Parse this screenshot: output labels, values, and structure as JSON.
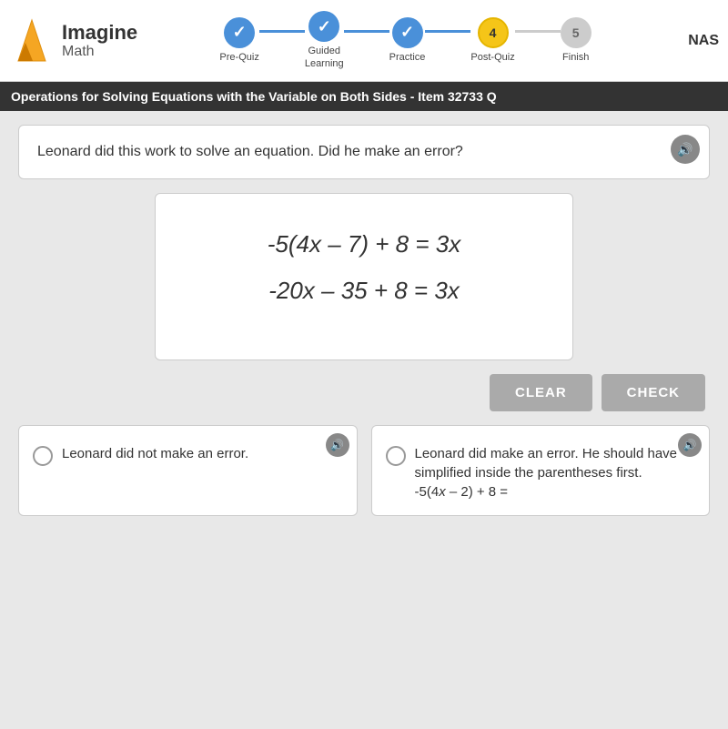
{
  "header": {
    "logo_imagine": "Imagine",
    "logo_math": "Math",
    "nas_label": "NAS"
  },
  "progress": {
    "steps": [
      {
        "id": "pre-quiz",
        "label": "Pre-Quiz",
        "state": "completed",
        "number": "✓"
      },
      {
        "id": "guided-learning",
        "label": "Guided\nLearning",
        "state": "completed",
        "number": "✓"
      },
      {
        "id": "practice",
        "label": "Practice",
        "state": "completed",
        "number": "✓"
      },
      {
        "id": "post-quiz",
        "label": "Post-Quiz",
        "state": "active",
        "number": "4"
      },
      {
        "id": "finish",
        "label": "Finish",
        "state": "future",
        "number": "5"
      }
    ]
  },
  "title_bar": {
    "text": "Operations for Solving Equations with the Variable on Both Sides - Item 32733  Q"
  },
  "question": {
    "text": "Leonard did this work to solve an equation. Did he make an error?",
    "speaker_label": "🔊"
  },
  "math_display": {
    "line1": "-5(4x – 7) + 8 = 3x",
    "line2": "-20x – 35 + 8 = 3x"
  },
  "buttons": {
    "clear_label": "CLEAR",
    "check_label": "CHECK"
  },
  "answer_options": [
    {
      "id": "option-a",
      "text": "Leonard did not make an error.",
      "speaker_label": "🔊"
    },
    {
      "id": "option-b",
      "text": "Leonard did make an error. He should have simplified inside the parentheses first.\n-5(4x – 2) + 8 =",
      "speaker_label": "🔊"
    }
  ]
}
